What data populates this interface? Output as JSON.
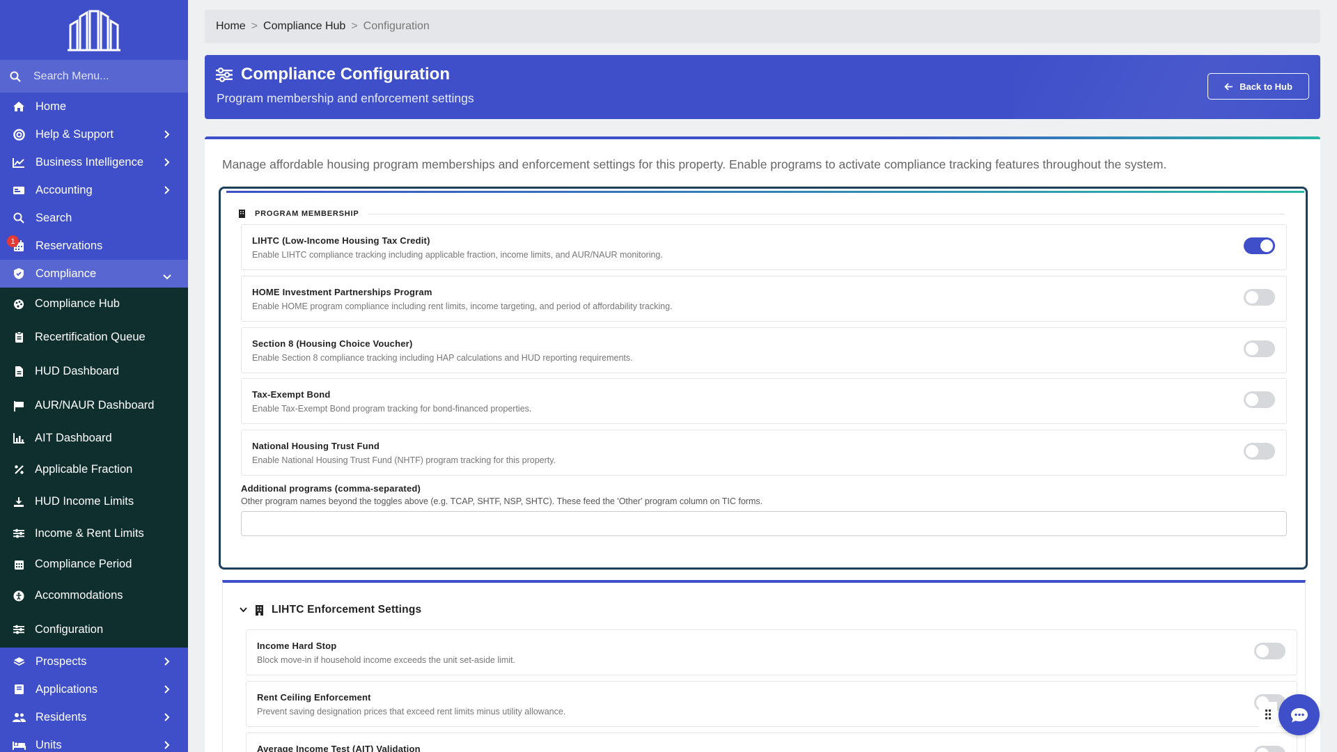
{
  "sidebar": {
    "search_placeholder": "Search Menu...",
    "items": [
      {
        "label": "Home",
        "icon": "home-icon"
      },
      {
        "label": "Help & Support",
        "icon": "lifebuoy-icon"
      },
      {
        "label": "Business Intelligence",
        "icon": "chart-line-icon"
      },
      {
        "label": "Accounting",
        "icon": "money-icon"
      },
      {
        "label": "Search",
        "icon": "search-icon"
      },
      {
        "label": "Reservations",
        "icon": "calendar-icon",
        "badge": "1"
      },
      {
        "label": "Compliance",
        "icon": "shield-icon"
      }
    ],
    "compliance_sub": [
      {
        "label": "Compliance Hub",
        "icon": "palette-icon"
      },
      {
        "label": "Recertification Queue",
        "icon": "clipboard-icon"
      },
      {
        "label": "HUD Dashboard",
        "icon": "file-icon"
      },
      {
        "label": "AUR/NAUR Dashboard",
        "icon": "flag-icon"
      },
      {
        "label": "AIT Dashboard",
        "icon": "bar-chart-icon"
      },
      {
        "label": "Applicable Fraction",
        "icon": "percent-icon"
      },
      {
        "label": "HUD Income Limits",
        "icon": "download-icon"
      },
      {
        "label": "Income & Rent Limits",
        "icon": "sliders-icon"
      },
      {
        "label": "Compliance Period",
        "icon": "calendar-grid-icon"
      },
      {
        "label": "Accommodations",
        "icon": "accessibility-icon"
      },
      {
        "label": "Configuration",
        "icon": "sliders-icon"
      }
    ],
    "bottom_items": [
      {
        "label": "Prospects",
        "icon": "layers-icon"
      },
      {
        "label": "Applications",
        "icon": "book-icon"
      },
      {
        "label": "Residents",
        "icon": "users-icon"
      },
      {
        "label": "Units",
        "icon": "bed-icon"
      }
    ]
  },
  "breadcrumb": {
    "home": "Home",
    "hub": "Compliance Hub",
    "current": "Configuration"
  },
  "header": {
    "title": "Compliance Configuration",
    "subtitle": "Program membership and enforcement settings",
    "back_button": "Back to Hub"
  },
  "intro": "Manage affordable housing program memberships and enforcement settings for this property. Enable programs to activate compliance tracking features throughout the system.",
  "program_section": {
    "title": "PROGRAM MEMBERSHIP",
    "programs": [
      {
        "title": "LIHTC (Low-Income Housing Tax Credit)",
        "desc": "Enable LIHTC compliance tracking including applicable fraction, income limits, and AUR/NAUR monitoring.",
        "on": true
      },
      {
        "title": "HOME Investment Partnerships Program",
        "desc": "Enable HOME program compliance including rent limits, income targeting, and period of affordability tracking.",
        "on": false
      },
      {
        "title": "Section 8 (Housing Choice Voucher)",
        "desc": "Enable Section 8 compliance tracking including HAP calculations and HUD reporting requirements.",
        "on": false
      },
      {
        "title": "Tax-Exempt Bond",
        "desc": "Enable Tax-Exempt Bond program tracking for bond-financed properties.",
        "on": false
      },
      {
        "title": "National Housing Trust Fund",
        "desc": "Enable National Housing Trust Fund (NHTF) program tracking for this property.",
        "on": false
      }
    ],
    "additional_label": "Additional programs (comma-separated)",
    "additional_help": "Other program names beyond the toggles above (e.g. TCAP, SHTF, NSP, SHTC). These feed the 'Other' program column on TIC forms.",
    "additional_value": ""
  },
  "lihtc_section": {
    "title": "LIHTC Enforcement Settings",
    "settings": [
      {
        "title": "Income Hard Stop",
        "desc": "Block move-in if household income exceeds the unit set-aside limit.",
        "on": false
      },
      {
        "title": "Rent Ceiling Enforcement",
        "desc": "Prevent saving designation prices that exceed rent limits minus utility allowance.",
        "on": false
      },
      {
        "title": "Average Income Test (AIT) Validation",
        "desc": "",
        "on": false
      }
    ]
  },
  "colors": {
    "primary": "#3e4fc9",
    "sidebar_sub": "#0f2e2e",
    "accent_teal": "#28b6a4"
  }
}
